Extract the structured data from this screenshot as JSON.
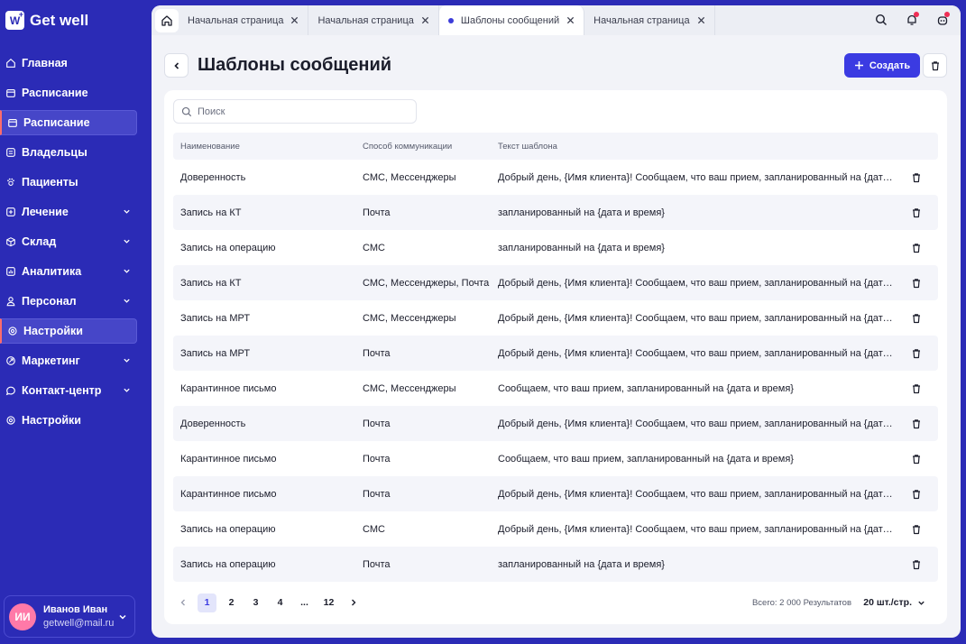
{
  "app": {
    "logo_mark": "W",
    "logo_text": "Get well"
  },
  "sidebar": {
    "items": [
      {
        "label": "Главная",
        "icon": "home-icon",
        "active": false,
        "chevron": false
      },
      {
        "label": "Расписание",
        "icon": "calendar-icon",
        "active": false,
        "chevron": false
      },
      {
        "label": "Расписание",
        "icon": "calendar-icon",
        "active": true,
        "chevron": false
      },
      {
        "label": "Владельцы",
        "icon": "owners-icon",
        "active": false,
        "chevron": false
      },
      {
        "label": "Пациенты",
        "icon": "paw-icon",
        "active": false,
        "chevron": false
      },
      {
        "label": "Лечение",
        "icon": "medical-icon",
        "active": false,
        "chevron": true
      },
      {
        "label": "Склад",
        "icon": "box-icon",
        "active": false,
        "chevron": true
      },
      {
        "label": "Аналитика",
        "icon": "chart-icon",
        "active": false,
        "chevron": true
      },
      {
        "label": "Персонал",
        "icon": "user-icon",
        "active": false,
        "chevron": true
      },
      {
        "label": "Настройки",
        "icon": "gear-icon",
        "active": true,
        "chevron": false
      },
      {
        "label": "Маркетинг",
        "icon": "marketing-icon",
        "active": false,
        "chevron": true
      },
      {
        "label": "Контакт-центр",
        "icon": "chat-icon",
        "active": false,
        "chevron": true
      },
      {
        "label": "Настройки",
        "icon": "gear-icon",
        "active": false,
        "chevron": false
      }
    ],
    "user": {
      "initials": "ИИ",
      "name": "Иванов Иван",
      "email": "getwell@mail.ru"
    }
  },
  "tabs": [
    {
      "label": "Начальная страница",
      "active": false
    },
    {
      "label": "Начальная страница",
      "active": false
    },
    {
      "label": "Шаблоны сообщений",
      "active": true
    },
    {
      "label": "Начальная страница",
      "active": false
    }
  ],
  "page": {
    "title": "Шаблоны сообщений",
    "create_label": "Создать",
    "search_placeholder": "Поиск"
  },
  "table": {
    "columns": [
      "Наименование",
      "Способ коммуникации",
      "Текст шаблона"
    ],
    "rows": [
      {
        "name": "Доверенность",
        "channel": "СМС, Мессенджеры",
        "text": "Добрый день, {Имя клиента}! Сообщаем, что ваш прием, запланированный на {дата и время}"
      },
      {
        "name": "Запись на КТ",
        "channel": "Почта",
        "text": "запланированный на {дата и время}"
      },
      {
        "name": "Запись на операцию",
        "channel": "СМС",
        "text": "запланированный на {дата и время}"
      },
      {
        "name": "Запись на КТ",
        "channel": "СМС, Мессенджеры, Почта",
        "text": "Добрый день, {Имя клиента}! Сообщаем, что ваш прием, запланированный на {дата и время}"
      },
      {
        "name": "Запись на МРТ",
        "channel": "СМС, Мессенджеры",
        "text": "Добрый день, {Имя клиента}! Сообщаем, что ваш прием, запланированный на {дата и время}"
      },
      {
        "name": "Запись на МРТ",
        "channel": "Почта",
        "text": "Добрый день, {Имя клиента}! Сообщаем, что ваш прием, запланированный на {дата и время}"
      },
      {
        "name": "Карантинное письмо",
        "channel": "СМС, Мессенджеры",
        "text": "Сообщаем, что ваш прием, запланированный на {дата и время}"
      },
      {
        "name": "Доверенность",
        "channel": "Почта",
        "text": "Добрый день, {Имя клиента}! Сообщаем, что ваш прием, запланированный на {дата и время}"
      },
      {
        "name": "Карантинное письмо",
        "channel": "Почта",
        "text": "Сообщаем, что ваш прием, запланированный на {дата и время}"
      },
      {
        "name": "Карантинное письмо",
        "channel": "Почта",
        "text": "Добрый день, {Имя клиента}! Сообщаем, что ваш прием, запланированный на {дата и время}"
      },
      {
        "name": "Запись на операцию",
        "channel": "СМС",
        "text": "Добрый день, {Имя клиента}! Сообщаем, что ваш прием, запланированный на {дата и время}"
      },
      {
        "name": "Запись на операцию",
        "channel": "Почта",
        "text": "запланированный на {дата и время}"
      }
    ]
  },
  "pagination": {
    "pages": [
      "1",
      "2",
      "3",
      "4",
      "...",
      "12"
    ],
    "current": "1",
    "total_label": "Всего: 2 000 Результатов",
    "page_size_label": "20 шт./стр."
  },
  "colors": {
    "sidebar": "#2b2bb6",
    "accent": "#3b3be2",
    "active_marker": "#ff6c6c",
    "badge": "#ef2e55"
  }
}
